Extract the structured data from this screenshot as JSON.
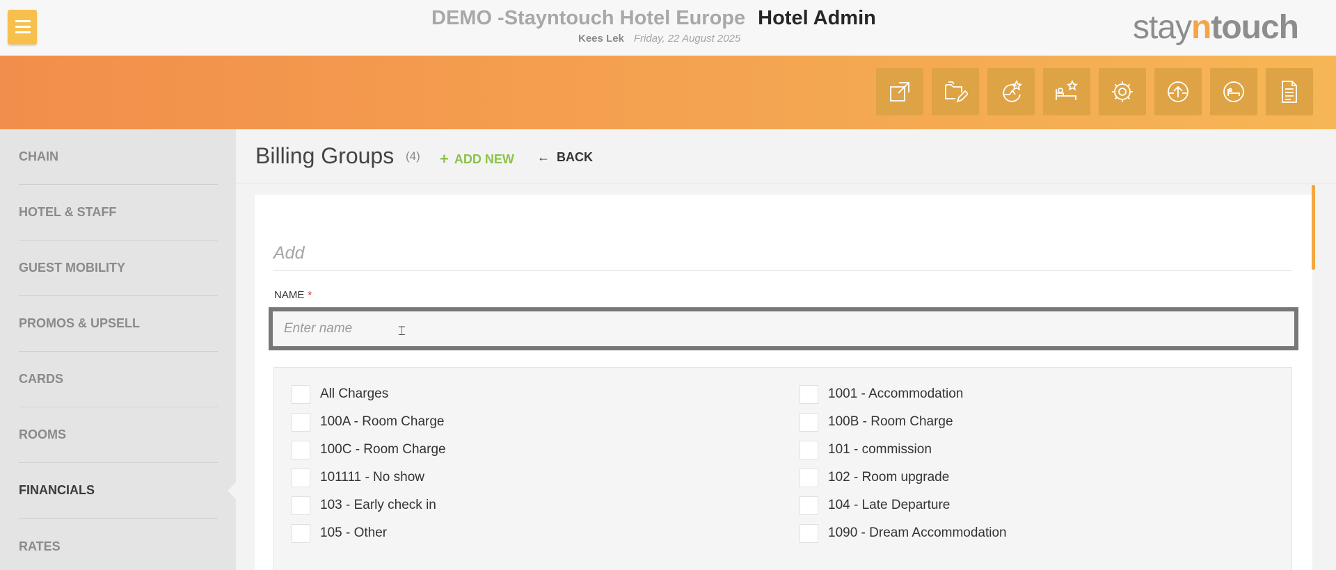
{
  "header": {
    "hotel_name": "DEMO -Stayntouch Hotel Europe",
    "app_name": "Hotel Admin",
    "user": "Kees Lek",
    "date": "Friday, 22 August 2025",
    "logo": {
      "part1": "stay",
      "part2": "n",
      "part3": "touch"
    }
  },
  "toolbar": [
    {
      "icon": "external-link-icon"
    },
    {
      "icon": "folder-edit-icon"
    },
    {
      "icon": "rate-star-icon"
    },
    {
      "icon": "room-star-icon"
    },
    {
      "icon": "gear-icon"
    },
    {
      "icon": "upload-icon"
    },
    {
      "icon": "bed-icon"
    },
    {
      "icon": "document-icon"
    }
  ],
  "sidebar": {
    "items": [
      {
        "label": "CHAIN"
      },
      {
        "label": "HOTEL & STAFF"
      },
      {
        "label": "GUEST MOBILITY"
      },
      {
        "label": "PROMOS & UPSELL"
      },
      {
        "label": "CARDS"
      },
      {
        "label": "ROOMS"
      },
      {
        "label": "FINANCIALS",
        "active": true
      },
      {
        "label": "RATES"
      }
    ]
  },
  "page": {
    "title": "Billing Groups",
    "count": "(4)",
    "add_new": "ADD NEW",
    "back": "BACK"
  },
  "form": {
    "section_title": "Add",
    "name_label": "NAME",
    "required_mark": "*",
    "name_placeholder": "Enter name",
    "name_value": "",
    "charges": [
      {
        "label": "All Charges",
        "checked": false
      },
      {
        "label": "1001 - Accommodation",
        "checked": false
      },
      {
        "label": "100A - Room Charge",
        "checked": false
      },
      {
        "label": "100B - Room Charge",
        "checked": false
      },
      {
        "label": "100C - Room Charge",
        "checked": false
      },
      {
        "label": "101 - commission",
        "checked": false
      },
      {
        "label": "101111 - No show",
        "checked": false
      },
      {
        "label": "102 - Room upgrade",
        "checked": false
      },
      {
        "label": "103 - Early check in",
        "checked": false
      },
      {
        "label": "104 - Late Departure",
        "checked": false
      },
      {
        "label": "105 - Other",
        "checked": false
      },
      {
        "label": "1090 - Dream Accommodation",
        "checked": false
      }
    ]
  },
  "colors": {
    "accent": "#f6b655",
    "band_start": "#f28e4b",
    "add_new": "#8ac34a",
    "required": "#d4312f"
  }
}
